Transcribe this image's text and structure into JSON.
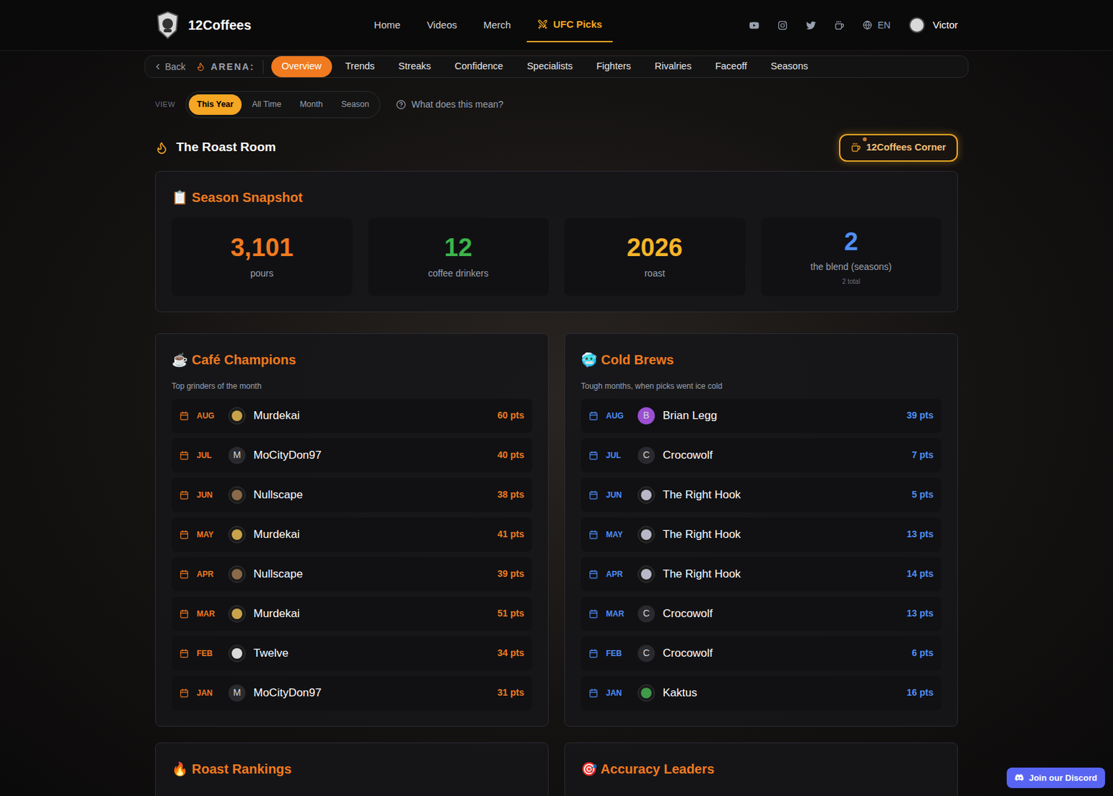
{
  "brand": "12Coffees",
  "nav": [
    {
      "label": "Home",
      "selected": false
    },
    {
      "label": "Videos",
      "selected": false
    },
    {
      "label": "Merch",
      "selected": false
    },
    {
      "label": "UFC Picks",
      "selected": true
    }
  ],
  "language": "EN",
  "user": "Victor",
  "subnav": {
    "back": "Back",
    "label": "ARENA:",
    "tabs": [
      {
        "label": "Overview",
        "selected": true
      },
      {
        "label": "Trends",
        "selected": false
      },
      {
        "label": "Streaks",
        "selected": false
      },
      {
        "label": "Confidence",
        "selected": false
      },
      {
        "label": "Specialists",
        "selected": false
      },
      {
        "label": "Fighters",
        "selected": false
      },
      {
        "label": "Rivalries",
        "selected": false
      },
      {
        "label": "Faceoff",
        "selected": false
      },
      {
        "label": "Seasons",
        "selected": false
      }
    ]
  },
  "view": {
    "label": "VIEW",
    "options": [
      {
        "label": "This Year",
        "selected": true
      },
      {
        "label": "All Time",
        "selected": false
      },
      {
        "label": "Month",
        "selected": false
      },
      {
        "label": "Season",
        "selected": false
      }
    ],
    "help": "What does this mean?"
  },
  "section_title": "The Roast Room",
  "corner_button": "12Coffees Corner",
  "snapshot": {
    "title": "📋 Season Snapshot",
    "stats": [
      {
        "value": "3,101",
        "label": "pours",
        "sub": "",
        "color": "#f07a1f"
      },
      {
        "value": "12",
        "label": "coffee drinkers",
        "sub": "",
        "color": "#3cb54a"
      },
      {
        "value": "2026",
        "label": "roast",
        "sub": "",
        "color": "#f5b52a"
      },
      {
        "value": "2",
        "label": "the blend (seasons)",
        "sub": "2 total",
        "color": "#4f8ff7"
      }
    ]
  },
  "champions": {
    "title": "☕ Café Champions",
    "subtitle": "Top grinders of the month",
    "rows": [
      {
        "month": "AUG",
        "name": "Murdekai",
        "pts": "60 pts",
        "avatar": {
          "kind": "image",
          "letter": "",
          "color": "#c9a34a"
        }
      },
      {
        "month": "JUL",
        "name": "MoCityDon97",
        "pts": "40 pts",
        "avatar": {
          "kind": "letter",
          "letter": "M",
          "color": "#2a2a2e"
        }
      },
      {
        "month": "JUN",
        "name": "Nullscape",
        "pts": "38 pts",
        "avatar": {
          "kind": "image",
          "letter": "",
          "color": "#8a6a4a"
        }
      },
      {
        "month": "MAY",
        "name": "Murdekai",
        "pts": "41 pts",
        "avatar": {
          "kind": "image",
          "letter": "",
          "color": "#c9a34a"
        }
      },
      {
        "month": "APR",
        "name": "Nullscape",
        "pts": "39 pts",
        "avatar": {
          "kind": "image",
          "letter": "",
          "color": "#8a6a4a"
        }
      },
      {
        "month": "MAR",
        "name": "Murdekai",
        "pts": "51 pts",
        "avatar": {
          "kind": "image",
          "letter": "",
          "color": "#c9a34a"
        }
      },
      {
        "month": "FEB",
        "name": "Twelve",
        "pts": "34 pts",
        "avatar": {
          "kind": "image",
          "letter": "",
          "color": "#d9d9d9"
        }
      },
      {
        "month": "JAN",
        "name": "MoCityDon97",
        "pts": "31 pts",
        "avatar": {
          "kind": "letter",
          "letter": "M",
          "color": "#2a2a2e"
        }
      }
    ]
  },
  "cold_brews": {
    "title": "🥶 Cold Brews",
    "subtitle": "Tough months, when picks went ice cold",
    "rows": [
      {
        "month": "AUG",
        "name": "Brian Legg",
        "pts": "39 pts",
        "avatar": {
          "kind": "letter",
          "letter": "B",
          "color": "#9b4fd1"
        }
      },
      {
        "month": "JUL",
        "name": "Crocowolf",
        "pts": "7 pts",
        "avatar": {
          "kind": "letter",
          "letter": "C",
          "color": "#2a2a2e"
        }
      },
      {
        "month": "JUN",
        "name": "The Right Hook",
        "pts": "5 pts",
        "avatar": {
          "kind": "image",
          "letter": "",
          "color": "#b8b8c8"
        }
      },
      {
        "month": "MAY",
        "name": "The Right Hook",
        "pts": "13 pts",
        "avatar": {
          "kind": "image",
          "letter": "",
          "color": "#b8b8c8"
        }
      },
      {
        "month": "APR",
        "name": "The Right Hook",
        "pts": "14 pts",
        "avatar": {
          "kind": "image",
          "letter": "",
          "color": "#b8b8c8"
        }
      },
      {
        "month": "MAR",
        "name": "Crocowolf",
        "pts": "13 pts",
        "avatar": {
          "kind": "letter",
          "letter": "C",
          "color": "#2a2a2e"
        }
      },
      {
        "month": "FEB",
        "name": "Crocowolf",
        "pts": "6 pts",
        "avatar": {
          "kind": "letter",
          "letter": "C",
          "color": "#2a2a2e"
        }
      },
      {
        "month": "JAN",
        "name": "Kaktus",
        "pts": "16 pts",
        "avatar": {
          "kind": "image",
          "letter": "",
          "color": "#3f9b4a"
        }
      }
    ]
  },
  "bottom_panels": [
    "🔥 Roast Rankings",
    "🎯 Accuracy Leaders"
  ],
  "discord_button": "Join our Discord"
}
